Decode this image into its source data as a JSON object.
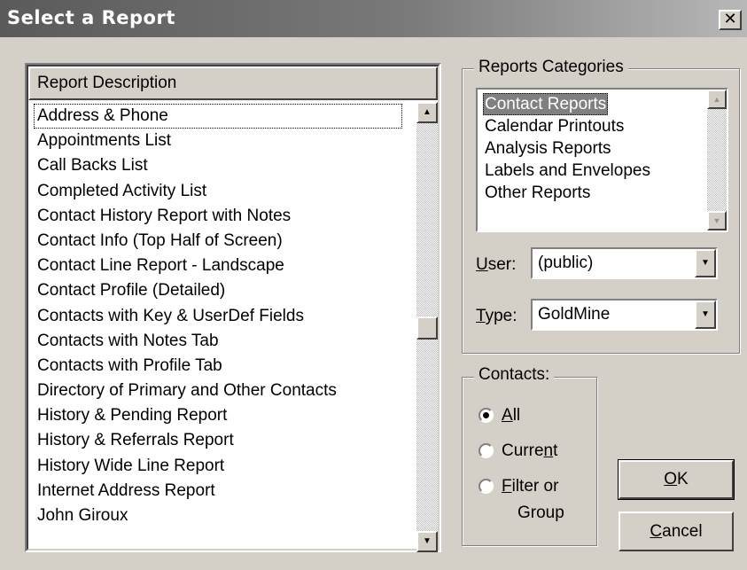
{
  "window": {
    "title": "Select a Report",
    "close_glyph": "✕"
  },
  "report_list": {
    "header": "Report Description",
    "items": [
      "Address & Phone",
      "Appointments List",
      "Call Backs List",
      "Completed Activity List",
      "Contact History Report with Notes",
      "Contact Info (Top Half of Screen)",
      "Contact Line Report - Landscape",
      "Contact Profile (Detailed)",
      "Contacts with Key & UserDef Fields",
      "Contacts with Notes Tab",
      "Contacts with Profile Tab",
      "Directory of Primary and Other Contacts",
      "History & Pending Report",
      "History & Referrals Report",
      "History Wide Line Report",
      "Internet Address Report",
      "John Giroux"
    ],
    "focused_item": "Address & Phone"
  },
  "categories": {
    "legend": "Reports Categories",
    "items": [
      "Contact Reports",
      "Calendar Printouts",
      "Analysis Reports",
      "Labels and Envelopes",
      "Other Reports"
    ],
    "selected": "Contact Reports"
  },
  "user": {
    "label_key": "U",
    "label_rest": "ser:",
    "value": "(public)"
  },
  "type": {
    "label_key": "T",
    "label_rest": "ype:",
    "value": "GoldMine"
  },
  "contacts": {
    "legend": "Contacts:",
    "options": [
      {
        "pre": "",
        "key": "A",
        "post": "ll",
        "selected": true
      },
      {
        "pre": "Curre",
        "key": "n",
        "post": "t",
        "selected": false
      },
      {
        "pre": "",
        "key": "F",
        "post": "ilter or",
        "line2": "Group",
        "selected": false
      }
    ]
  },
  "buttons": {
    "ok": {
      "key": "O",
      "rest": "K"
    },
    "cancel": {
      "key": "C",
      "rest": "ancel"
    }
  },
  "icons": {
    "close": "close-icon",
    "scroll_up": "arrow-up-icon",
    "scroll_down": "arrow-down-icon",
    "dropdown": "chevron-down-icon"
  }
}
